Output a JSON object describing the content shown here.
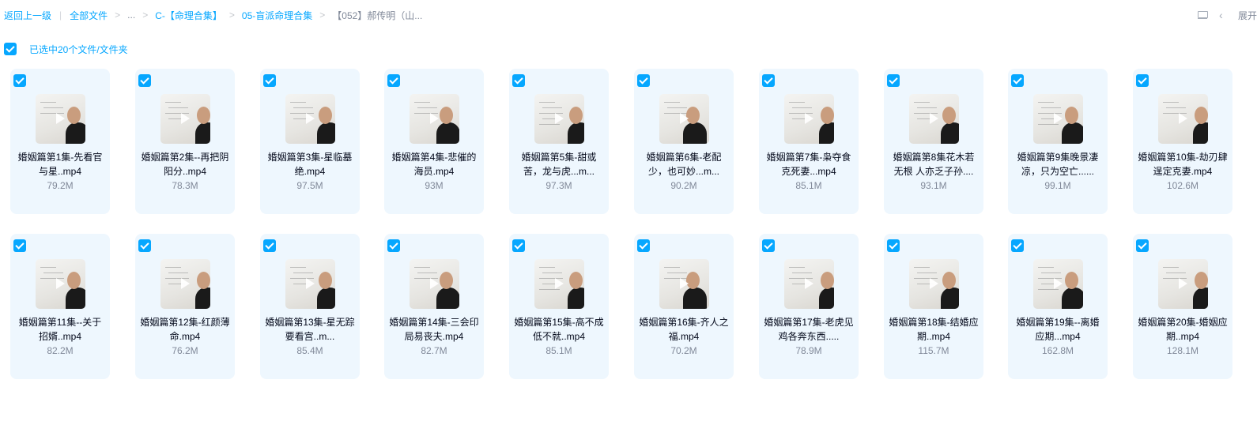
{
  "breadcrumb": {
    "back": "返回上一级",
    "all_files": "全部文件",
    "ellipsis": "...",
    "level1": "C-【命理合集】",
    "level2": "05-盲派命理合集",
    "current": "【052】郝传明（山..."
  },
  "toolbar": {
    "list_icon": "list-view-icon",
    "collapse_icon": "chevron-left-icon",
    "expand_label": "展开"
  },
  "selection": {
    "checked": true,
    "text": "已选中20个文件/文件夹"
  },
  "files": [
    {
      "name": "婚姻篇第1集-先看官与星..mp4",
      "size": "79.2M"
    },
    {
      "name": "婚姻篇第2集--再把阴阳分..mp4",
      "size": "78.3M"
    },
    {
      "name": "婚姻篇第3集-星临墓绝.mp4",
      "size": "97.5M"
    },
    {
      "name": "婚姻篇第4集-悲催的海员.mp4",
      "size": "93M"
    },
    {
      "name": "婚姻篇第5集-甜或苦，龙与虎...m...",
      "size": "97.3M"
    },
    {
      "name": "婚姻篇第6集-老配少，也可妙...m...",
      "size": "90.2M"
    },
    {
      "name": "婚姻篇第7集-枭夺食克死妻...mp4",
      "size": "85.1M"
    },
    {
      "name": "婚姻篇第8集花木若无根 人亦乏子孙....",
      "size": "93.1M"
    },
    {
      "name": "婚姻篇第9集晚景凄凉，只为空亡......",
      "size": "99.1M"
    },
    {
      "name": "婚姻篇第10集-劫刃肆逞定克妻.mp4",
      "size": "102.6M"
    },
    {
      "name": "婚姻篇第11集--关于招婿..mp4",
      "size": "82.2M"
    },
    {
      "name": "婚姻篇第12集-红颜薄命.mp4",
      "size": "76.2M"
    },
    {
      "name": "婚姻篇第13集-星无踪 要看宫..m...",
      "size": "85.4M"
    },
    {
      "name": "婚姻篇第14集-三会印局易丧夫.mp4",
      "size": "82.7M"
    },
    {
      "name": "婚姻篇第15集-高不成低不就..mp4",
      "size": "85.1M"
    },
    {
      "name": "婚姻篇第16集-齐人之福.mp4",
      "size": "70.2M"
    },
    {
      "name": "婚姻篇第17集-老虎见鸡各奔东西.....",
      "size": "78.9M"
    },
    {
      "name": "婚姻篇第18集-结婚应期..mp4",
      "size": "115.7M"
    },
    {
      "name": "婚姻篇第19集--离婚应期...mp4",
      "size": "162.8M"
    },
    {
      "name": "婚姻篇第20集-婚姻应期..mp4",
      "size": "128.1M"
    }
  ]
}
